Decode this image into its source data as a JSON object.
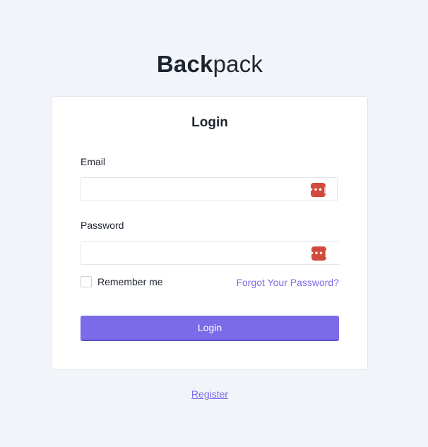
{
  "brand": {
    "bold": "Back",
    "regular": "pack"
  },
  "login_card": {
    "title": "Login",
    "email": {
      "label": "Email",
      "value": "",
      "placeholder": ""
    },
    "password": {
      "label": "Password",
      "value": "",
      "placeholder": ""
    },
    "remember": {
      "label": "Remember me",
      "checked": false
    },
    "forgot_link": "Forgot Your Password?",
    "submit_label": "Login"
  },
  "register_link": "Register",
  "colors": {
    "accent": "#7b6be8",
    "link": "#7c69ef",
    "password_manager_icon": "#d14b3c",
    "background": "#f1f4f8"
  },
  "icons": {
    "field_icon": "password-manager-icon"
  }
}
